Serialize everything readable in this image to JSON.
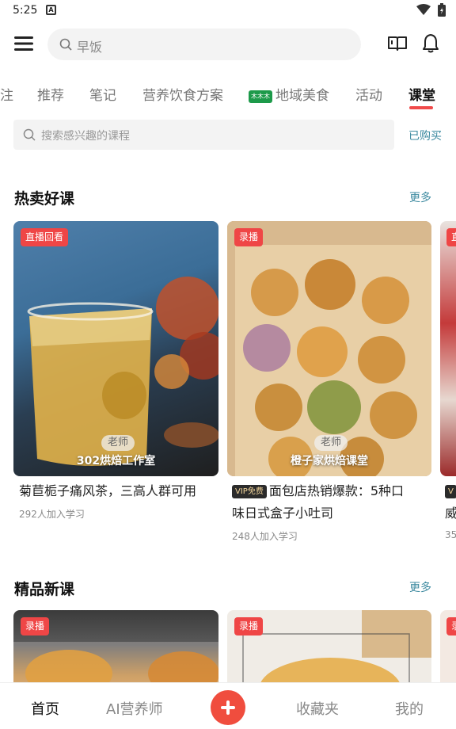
{
  "status": {
    "time": "5:25",
    "notif_letter": "A"
  },
  "search": {
    "placeholder": "早饭"
  },
  "tabs": [
    "注",
    "推荐",
    "笔记",
    "营养饮食方案",
    "地域美食",
    "活动",
    "课堂"
  ],
  "active_tab": "课堂",
  "course_search": {
    "placeholder": "搜索感兴趣的课程",
    "purchased_label": "已购买"
  },
  "hot": {
    "title": "热卖好课",
    "more": "更多",
    "cards": [
      {
        "tag": "直播回看",
        "teacher_label": "老师",
        "teacher": "302烘焙工作室",
        "title": "菊苣栀子痛风茶，三高人群可用",
        "count": "292人加入学习"
      },
      {
        "tag": "录播",
        "teacher_label": "老师",
        "teacher": "橙子家烘焙课堂",
        "vip": "VIP免费",
        "title_line1": "面包店热销爆款：5种口",
        "title_line2": "味日式盒子小吐司",
        "count": "248人加入学习"
      },
      {
        "tag": "直",
        "vip": "V",
        "title": "威",
        "count": "35"
      }
    ]
  },
  "premium": {
    "title": "精品新课",
    "more": "更多",
    "cards": [
      {
        "tag": "录播"
      },
      {
        "tag": "录播"
      },
      {
        "tag": "录"
      }
    ]
  },
  "bottom_nav": {
    "home": "首页",
    "ai": "AI营养师",
    "favorites": "收藏夹",
    "me": "我的"
  },
  "colors": {
    "accent": "#f04a4a",
    "link": "#3d8aa0",
    "tag": "#ef4646"
  }
}
